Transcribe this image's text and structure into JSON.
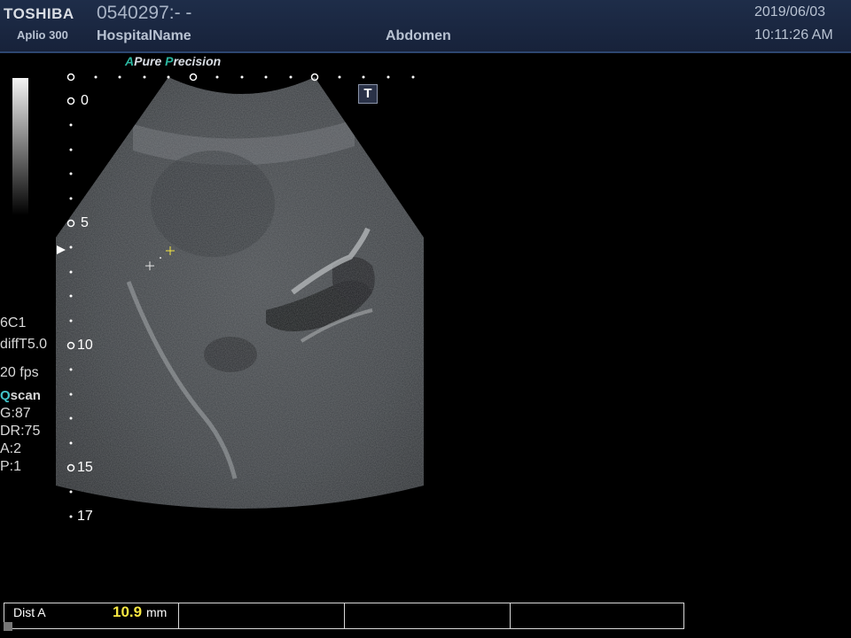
{
  "header": {
    "brand": "TOSHIBA",
    "model": "Aplio 300",
    "patient_id": "0540297:- -",
    "hospital": "HospitalName",
    "exam": "Abdomen",
    "date": "2019/06/03",
    "time": "10:11:26 AM"
  },
  "tagline": {
    "a": "A",
    "pure": "Pure ",
    "p": "P",
    "recision": "recision"
  },
  "marker_t": "T",
  "depth_labels": [
    "0",
    "5",
    "10",
    "15",
    "17"
  ],
  "params": {
    "probe": "6C1",
    "mode": "diffT5.0",
    "fps": "20 fps",
    "qscan_q": "Q",
    "qscan_rest": "scan",
    "gain": "G:87",
    "dr": "DR:75",
    "a": "A:2",
    "p": "P:1"
  },
  "measurement": {
    "label": "Dist A",
    "value": "10.9",
    "unit": "mm"
  },
  "colors": {
    "header_bg": "#1e2d49",
    "tagline_accent": "#2bb59f",
    "value": "#f5e642",
    "qscan": "#42c3c8"
  }
}
